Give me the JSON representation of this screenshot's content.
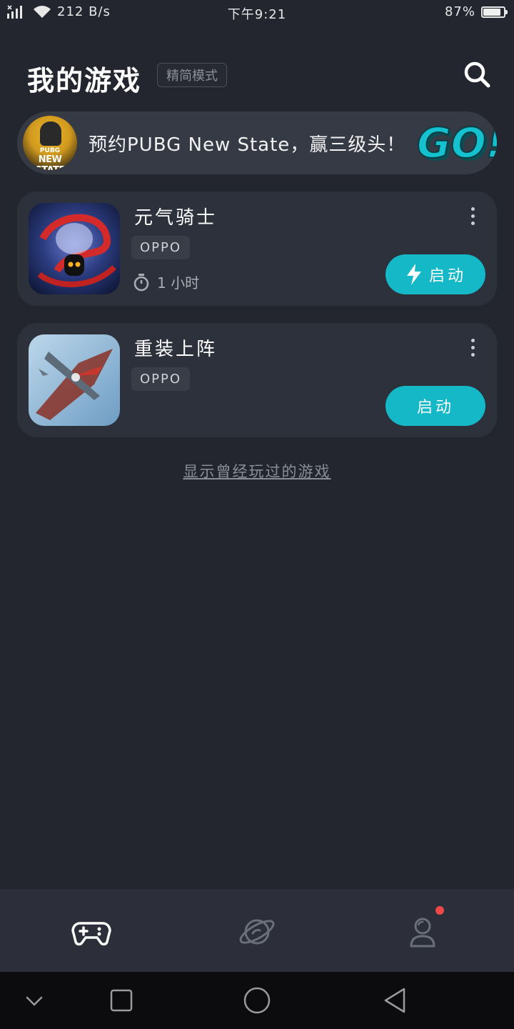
{
  "status_bar": {
    "network_speed": "212 B/s",
    "time": "下午9:21",
    "battery_percent": "87%",
    "battery_level": 0.87
  },
  "header": {
    "title": "我的游戏",
    "mode_label": "精简模式",
    "search_icon": "search-icon"
  },
  "banner": {
    "text": "预约PUBG New State，赢三级头！",
    "logo_line1": "PUBG",
    "logo_line2": "NEW STATE",
    "go_text": "GO!"
  },
  "games": [
    {
      "name": "元气骑士",
      "publisher": "OPPO",
      "playtime": "1 小时",
      "launch_label": "启动",
      "launch_icon": "lightning-icon"
    },
    {
      "name": "重装上阵",
      "publisher": "OPPO",
      "launch_label": "启动"
    }
  ],
  "history_link": "显示曾经玩过的游戏",
  "tab_bar": {
    "items": [
      "gamepad-icon",
      "planet-icon",
      "profile-icon"
    ],
    "notification_color": "#f04848"
  },
  "colors": {
    "accent": "#14b8c6",
    "background": "#23262f",
    "card": "#2d313b"
  }
}
